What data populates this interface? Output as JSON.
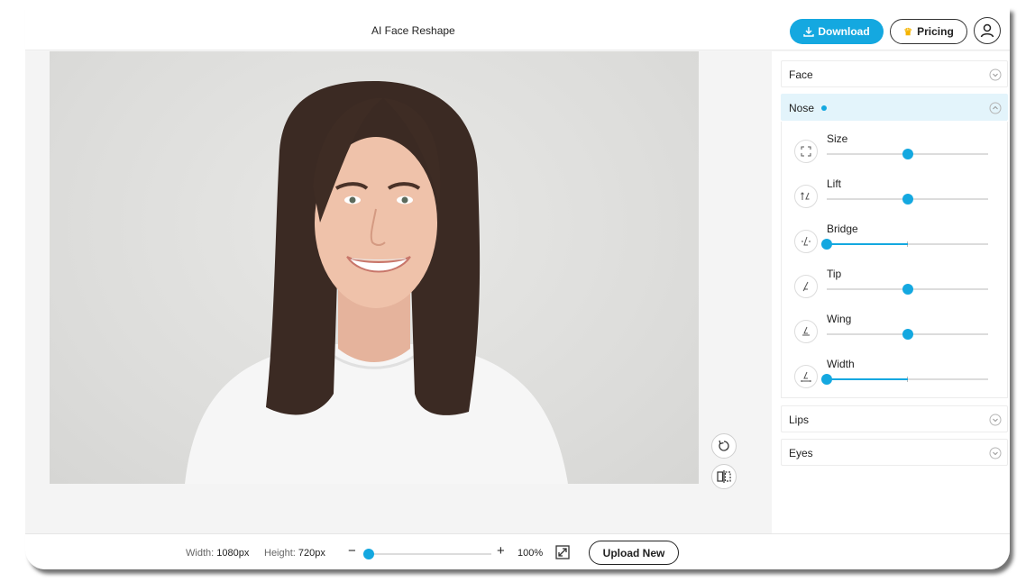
{
  "header": {
    "title": "AI Face Reshape",
    "download_label": "Download",
    "pricing_label": "Pricing"
  },
  "panel": {
    "sections": [
      {
        "label": "Face",
        "expanded": false
      },
      {
        "label": "Nose",
        "expanded": true,
        "modified": true
      },
      {
        "label": "Lips",
        "expanded": false
      },
      {
        "label": "Eyes",
        "expanded": false
      }
    ],
    "nose_sliders": [
      {
        "label": "Size",
        "icon": "expand-icon",
        "value": 0.5
      },
      {
        "label": "Lift",
        "icon": "nose-lift-icon",
        "value": 0.5
      },
      {
        "label": "Bridge",
        "icon": "nose-bridge-icon",
        "value": 0.0
      },
      {
        "label": "Tip",
        "icon": "nose-tip-icon",
        "value": 0.5
      },
      {
        "label": "Wing",
        "icon": "nose-wing-icon",
        "value": 0.5
      },
      {
        "label": "Width",
        "icon": "nose-width-icon",
        "value": 0.0
      }
    ]
  },
  "footer": {
    "width_label": "Width:",
    "width_value": "1080px",
    "height_label": "Height:",
    "height_value": "720px",
    "zoom_minus": "−",
    "zoom_plus": "+",
    "zoom_value": "100%",
    "zoom_level": 0.0,
    "upload_label": "Upload New"
  },
  "colors": {
    "accent": "#14a8e0",
    "active_section_bg": "#e3f4fb"
  }
}
